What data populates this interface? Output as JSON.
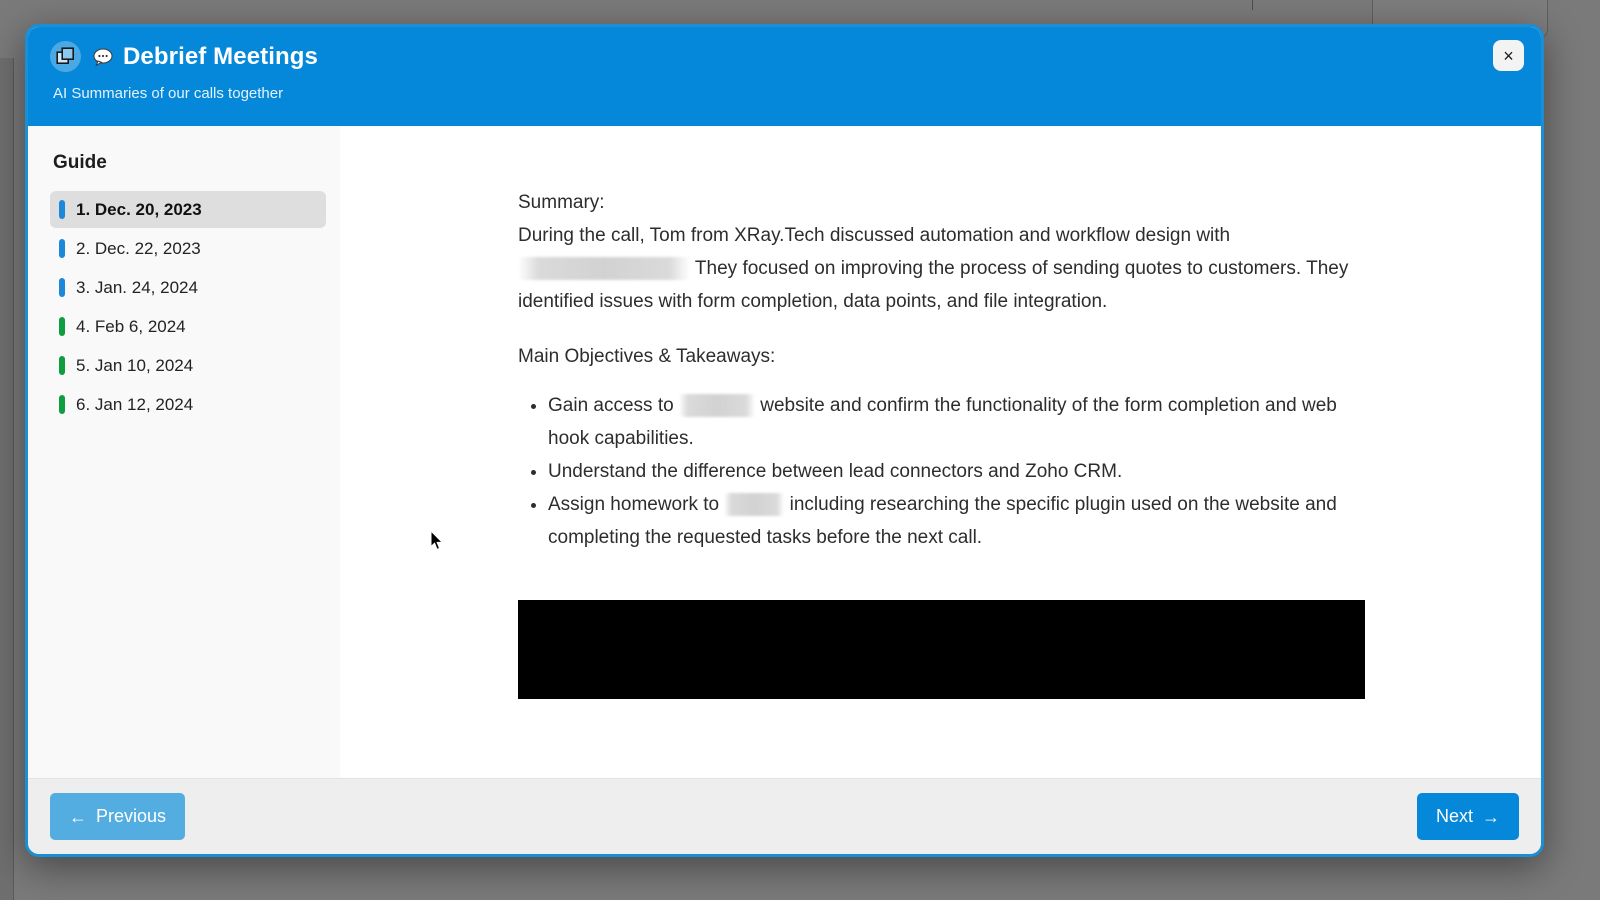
{
  "header": {
    "badge_icon": "copy-windows-icon",
    "emoji_icon": "speech-bubble-icon",
    "title": "Debrief Meetings",
    "subtitle": "AI Summaries of our calls together",
    "close_label": "×",
    "close_icon": "close-icon",
    "background_color": "#0588da"
  },
  "sidebar": {
    "heading": "Guide",
    "items": [
      {
        "label": "1. Dec. 20, 2023",
        "marker_color": "#1e88d8",
        "selected": true
      },
      {
        "label": "2. Dec. 22, 2023",
        "marker_color": "#1e88d8",
        "selected": false
      },
      {
        "label": "3. Jan. 24, 2024",
        "marker_color": "#1e88d8",
        "selected": false
      },
      {
        "label": "4. Feb 6, 2024",
        "marker_color": "#0f9d3f",
        "selected": false
      },
      {
        "label": "5. Jan 10, 2024",
        "marker_color": "#0f9d3f",
        "selected": false
      },
      {
        "label": "6. Jan 12, 2024",
        "marker_color": "#0f9d3f",
        "selected": false
      }
    ]
  },
  "content": {
    "summary_heading": "Summary:",
    "summary_part1": "During the call, Tom from XRay.Tech discussed automation and workflow design with ",
    "summary_redaction_1": "[redacted]",
    "summary_part2": " They focused on improving the process of sending quotes to customers. They identified issues with form completion, data points, and file integration.",
    "objectives_heading": "Main Objectives & Takeaways:",
    "bullets": [
      {
        "before": "Gain access to ",
        "redaction": "[redacted]",
        "after": " website and confirm the functionality of the form completion and web hook capabilities."
      },
      {
        "before": "Understand the difference between lead connectors and Zoho CRM.",
        "redaction": "",
        "after": ""
      },
      {
        "before": "Assign homework to ",
        "redaction": "[redacted]",
        "after": " including researching the specific plugin used on the website and completing the requested tasks before the next call."
      }
    ],
    "media_placeholder": "video-player"
  },
  "footer": {
    "previous_label": "Previous",
    "previous_arrow": "←",
    "previous_color": "#53ade0",
    "next_label": "Next",
    "next_arrow": "→",
    "next_color": "#0588da"
  }
}
